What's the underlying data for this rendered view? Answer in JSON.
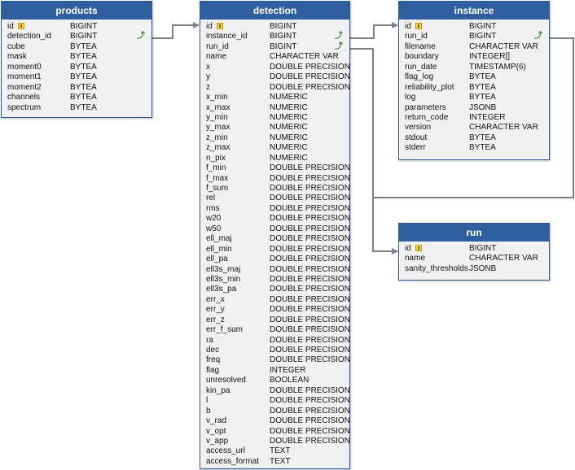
{
  "tables": {
    "products": {
      "title": "products",
      "columns": [
        {
          "name": "id",
          "type": "BIGINT",
          "pk": true
        },
        {
          "name": "detection_id",
          "type": "BIGINT",
          "fk": true
        },
        {
          "name": "cube",
          "type": "BYTEA"
        },
        {
          "name": "mask",
          "type": "BYTEA"
        },
        {
          "name": "moment0",
          "type": "BYTEA"
        },
        {
          "name": "moment1",
          "type": "BYTEA"
        },
        {
          "name": "moment2",
          "type": "BYTEA"
        },
        {
          "name": "channels",
          "type": "BYTEA"
        },
        {
          "name": "spectrum",
          "type": "BYTEA"
        }
      ]
    },
    "detection": {
      "title": "detection",
      "columns": [
        {
          "name": "id",
          "type": "BIGINT",
          "pk": true
        },
        {
          "name": "instance_id",
          "type": "BIGINT",
          "fk": true
        },
        {
          "name": "run_id",
          "type": "BIGINT",
          "fk": true
        },
        {
          "name": "name",
          "type": "CHARACTER VAR"
        },
        {
          "name": "x",
          "type": "DOUBLE PRECISION"
        },
        {
          "name": "y",
          "type": "DOUBLE PRECISION"
        },
        {
          "name": "z",
          "type": "DOUBLE PRECISION"
        },
        {
          "name": "x_min",
          "type": "NUMERIC"
        },
        {
          "name": "x_max",
          "type": "NUMERIC"
        },
        {
          "name": "y_min",
          "type": "NUMERIC"
        },
        {
          "name": "y_max",
          "type": "NUMERIC"
        },
        {
          "name": "z_min",
          "type": "NUMERIC"
        },
        {
          "name": "z_max",
          "type": "NUMERIC"
        },
        {
          "name": "n_pix",
          "type": "NUMERIC"
        },
        {
          "name": "f_min",
          "type": "DOUBLE PRECISION"
        },
        {
          "name": "f_max",
          "type": "DOUBLE PRECISION"
        },
        {
          "name": "f_sum",
          "type": "DOUBLE PRECISION"
        },
        {
          "name": "rel",
          "type": "DOUBLE PRECISION"
        },
        {
          "name": "rms",
          "type": "DOUBLE PRECISION"
        },
        {
          "name": "w20",
          "type": "DOUBLE PRECISION"
        },
        {
          "name": "w50",
          "type": "DOUBLE PRECISION"
        },
        {
          "name": "ell_maj",
          "type": "DOUBLE PRECISION"
        },
        {
          "name": "ell_min",
          "type": "DOUBLE PRECISION"
        },
        {
          "name": "ell_pa",
          "type": "DOUBLE PRECISION"
        },
        {
          "name": "ell3s_maj",
          "type": "DOUBLE PRECISION"
        },
        {
          "name": "ell3s_min",
          "type": "DOUBLE PRECISION"
        },
        {
          "name": "ell3s_pa",
          "type": "DOUBLE PRECISION"
        },
        {
          "name": "err_x",
          "type": "DOUBLE PRECISION"
        },
        {
          "name": "err_y",
          "type": "DOUBLE PRECISION"
        },
        {
          "name": "err_z",
          "type": "DOUBLE PRECISION"
        },
        {
          "name": "err_f_sum",
          "type": "DOUBLE PRECISION"
        },
        {
          "name": "ra",
          "type": "DOUBLE PRECISION"
        },
        {
          "name": "dec",
          "type": "DOUBLE PRECISION"
        },
        {
          "name": "freq",
          "type": "DOUBLE PRECISION"
        },
        {
          "name": "flag",
          "type": "INTEGER"
        },
        {
          "name": "unresolved",
          "type": "BOOLEAN"
        },
        {
          "name": "kin_pa",
          "type": "DOUBLE PRECISION"
        },
        {
          "name": "l",
          "type": "DOUBLE PRECISION"
        },
        {
          "name": "b",
          "type": "DOUBLE PRECISION"
        },
        {
          "name": "v_rad",
          "type": "DOUBLE PRECISION"
        },
        {
          "name": "v_opt",
          "type": "DOUBLE PRECISION"
        },
        {
          "name": "v_app",
          "type": "DOUBLE PRECISION"
        },
        {
          "name": "access_url",
          "type": "TEXT"
        },
        {
          "name": "access_format",
          "type": "TEXT"
        }
      ]
    },
    "instance": {
      "title": "instance",
      "columns": [
        {
          "name": "id",
          "type": "BIGINT",
          "pk": true
        },
        {
          "name": "run_id",
          "type": "BIGINT",
          "fk": true
        },
        {
          "name": "filename",
          "type": "CHARACTER VAR"
        },
        {
          "name": "boundary",
          "type": "INTEGER[]"
        },
        {
          "name": "run_date",
          "type": "TIMESTAMP(6)"
        },
        {
          "name": "flag_log",
          "type": "BYTEA"
        },
        {
          "name": "reliability_plot",
          "type": "BYTEA"
        },
        {
          "name": "log",
          "type": "BYTEA"
        },
        {
          "name": "parameters",
          "type": "JSONB"
        },
        {
          "name": "return_code",
          "type": "INTEGER"
        },
        {
          "name": "version",
          "type": "CHARACTER VAR"
        },
        {
          "name": "stdout",
          "type": "BYTEA"
        },
        {
          "name": "stderr",
          "type": "BYTEA"
        }
      ]
    },
    "run": {
      "title": "run",
      "columns": [
        {
          "name": "id",
          "type": "BIGINT",
          "pk": true
        },
        {
          "name": "name",
          "type": "CHARACTER VAR"
        },
        {
          "name": "sanity_thresholds",
          "type": "JSONB"
        }
      ]
    }
  },
  "colors": {
    "header": "#2f5f9f",
    "border": "#2c5a9a",
    "body": "#f1f1f1",
    "connector": "#808080",
    "fk_marker": "#2a8a3a",
    "pk_key": "#f6d45a"
  },
  "icons": {
    "primary_key": "key-icon",
    "foreign_key": "fk-arrow-icon"
  }
}
